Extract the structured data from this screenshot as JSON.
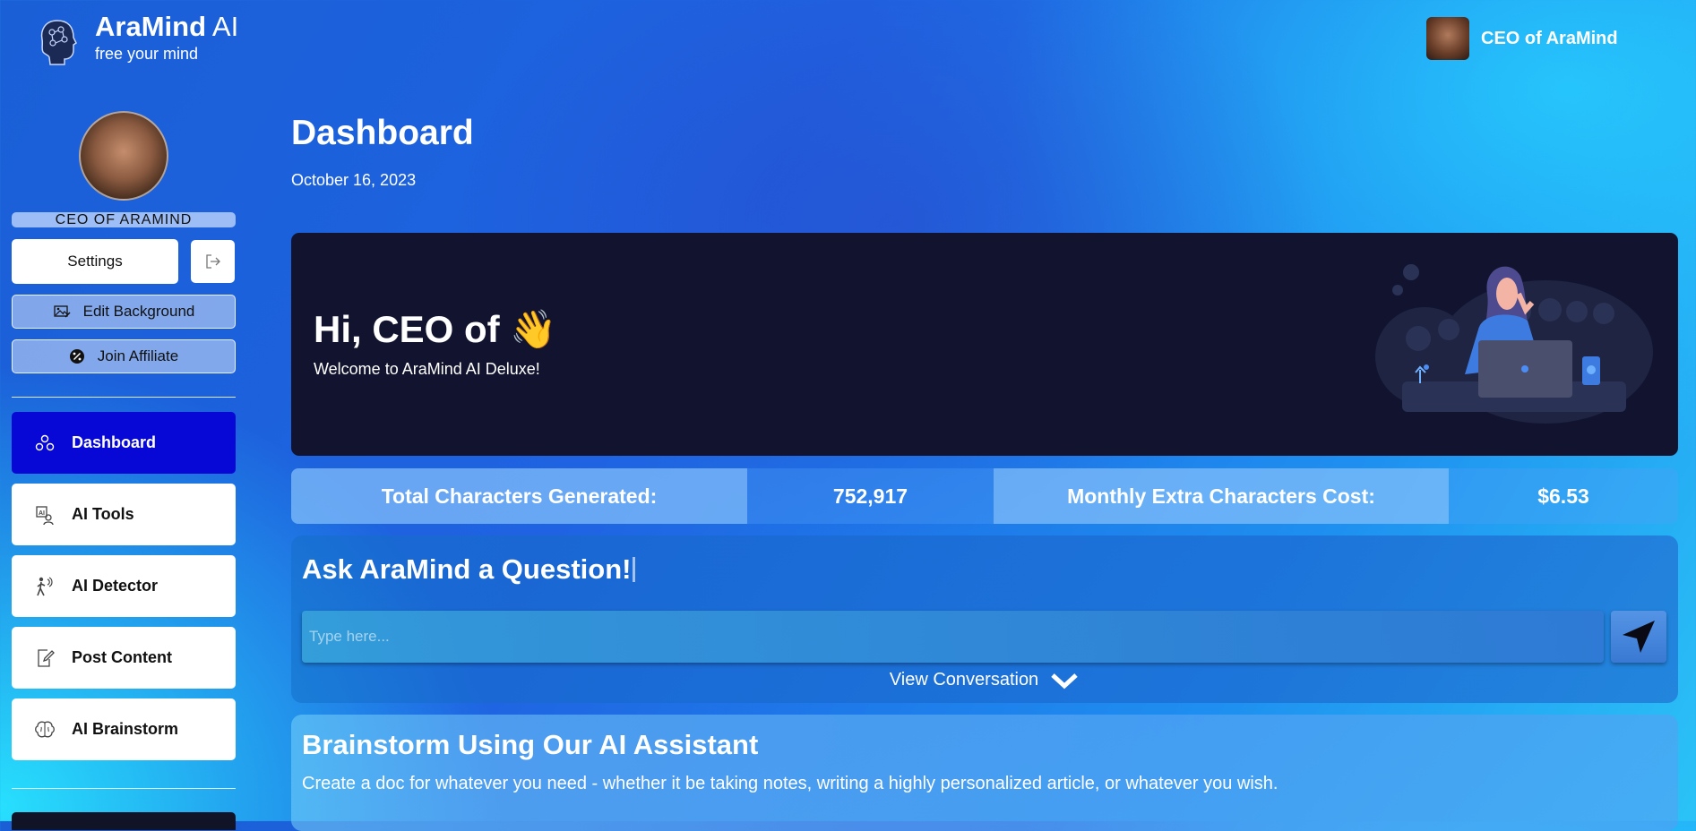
{
  "brand": {
    "name": "AraMind",
    "suffix": "AI",
    "tagline": "free your mind"
  },
  "user": {
    "name": "CEO of AraMind",
    "role_label": "CEO OF ARAMIND"
  },
  "sidebar": {
    "settings_label": "Settings",
    "edit_background_label": "Edit Background",
    "join_affiliate_label": "Join Affiliate",
    "nav": [
      {
        "label": "Dashboard",
        "icon": "shapes-icon",
        "active": true
      },
      {
        "label": "AI Tools",
        "icon": "ai-tools-icon",
        "active": false
      },
      {
        "label": "AI Detector",
        "icon": "detector-icon",
        "active": false
      },
      {
        "label": "Post Content",
        "icon": "edit-doc-icon",
        "active": false
      },
      {
        "label": "AI Brainstorm",
        "icon": "brain-icon",
        "active": false
      }
    ]
  },
  "page": {
    "title": "Dashboard",
    "date": "October 16, 2023"
  },
  "hero": {
    "greeting": "Hi, CEO of 👋",
    "subtitle": "Welcome to AraMind AI Deluxe!"
  },
  "stats": {
    "total_label": "Total Characters Generated:",
    "total_value": "752,917",
    "cost_label": "Monthly Extra Characters Cost:",
    "cost_value": "$6.53"
  },
  "ask": {
    "title": "Ask AraMind a Question!",
    "placeholder": "Type here...",
    "view_conversation": "View Conversation"
  },
  "brainstorm": {
    "title": "Brainstorm Using Our AI Assistant",
    "description": "Create a doc for whatever you need - whether it be taking notes, writing a highly personalized article, or whatever you wish."
  },
  "colors": {
    "active_nav": "#0707d6",
    "hero_bg": "#12142f",
    "accent_blue": "#4c8df5"
  }
}
